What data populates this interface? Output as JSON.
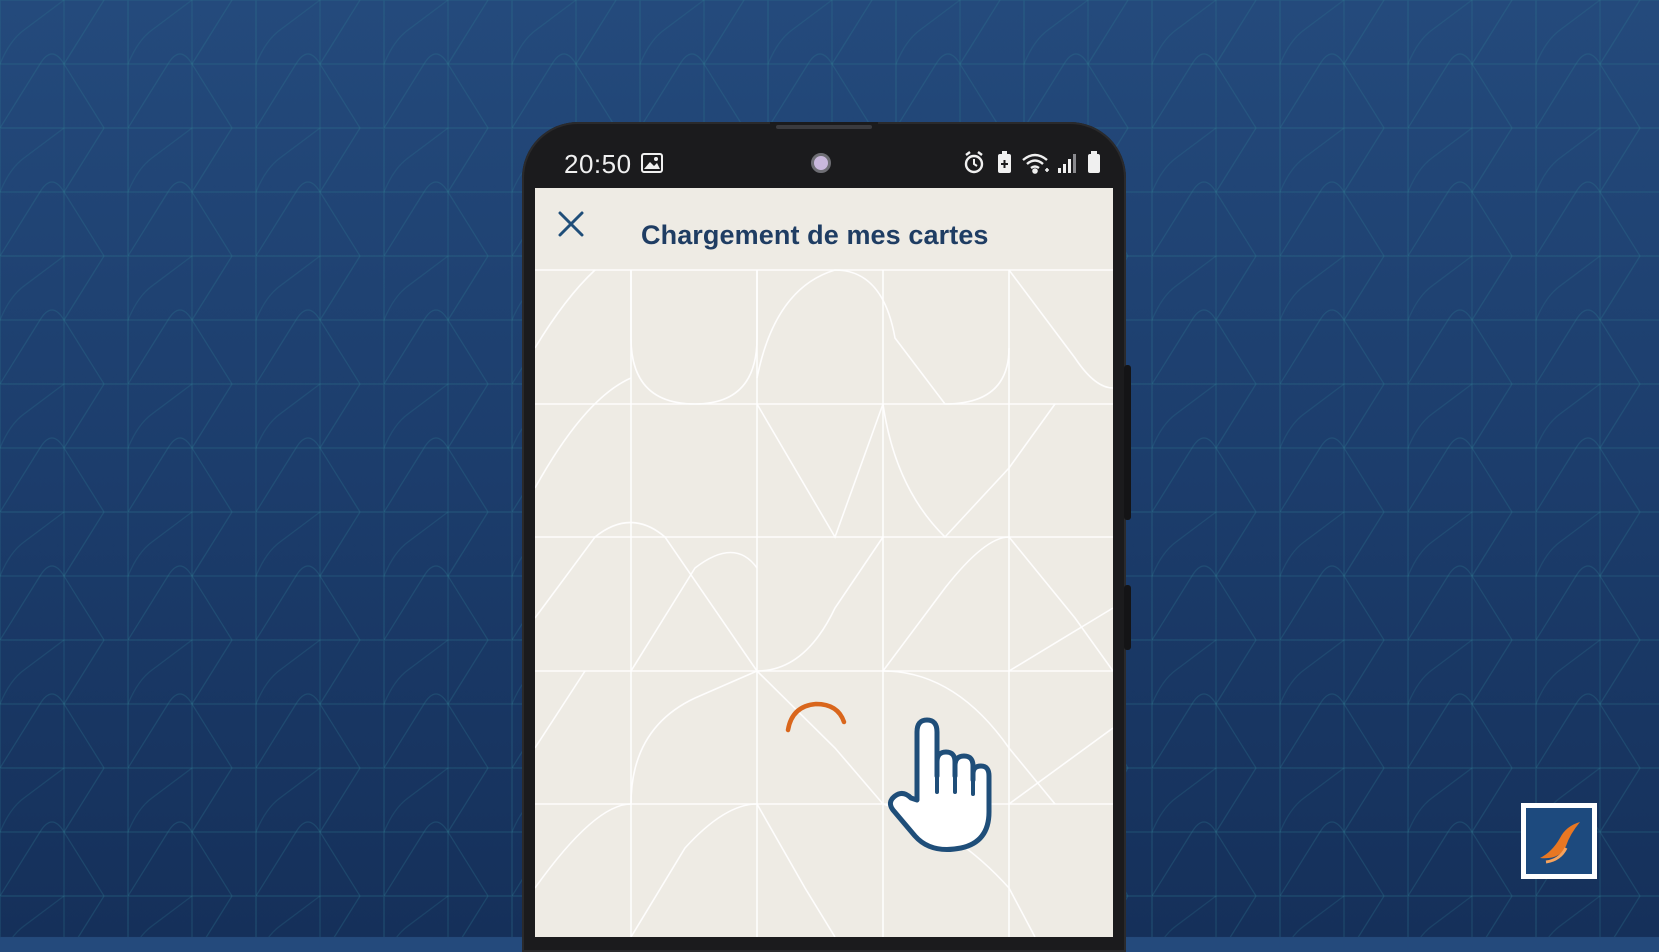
{
  "statusbar": {
    "time": "20:50",
    "icons": [
      "image-icon",
      "alarm-icon",
      "battery-saver-icon",
      "wifi-icon",
      "signal-icon",
      "battery-icon"
    ]
  },
  "header": {
    "close_icon": "close-icon",
    "title": "Chargement de mes cartes"
  },
  "loading": {
    "spinner_color": "#d9661c"
  },
  "colors": {
    "background": "#1c3d6c",
    "screen": "#eeebe4",
    "title": "#1f3d63",
    "hand_outline": "#1f4e79",
    "logo_orange": "#e87722"
  },
  "brand": {
    "logo_icon": "brand-logo-icon"
  }
}
